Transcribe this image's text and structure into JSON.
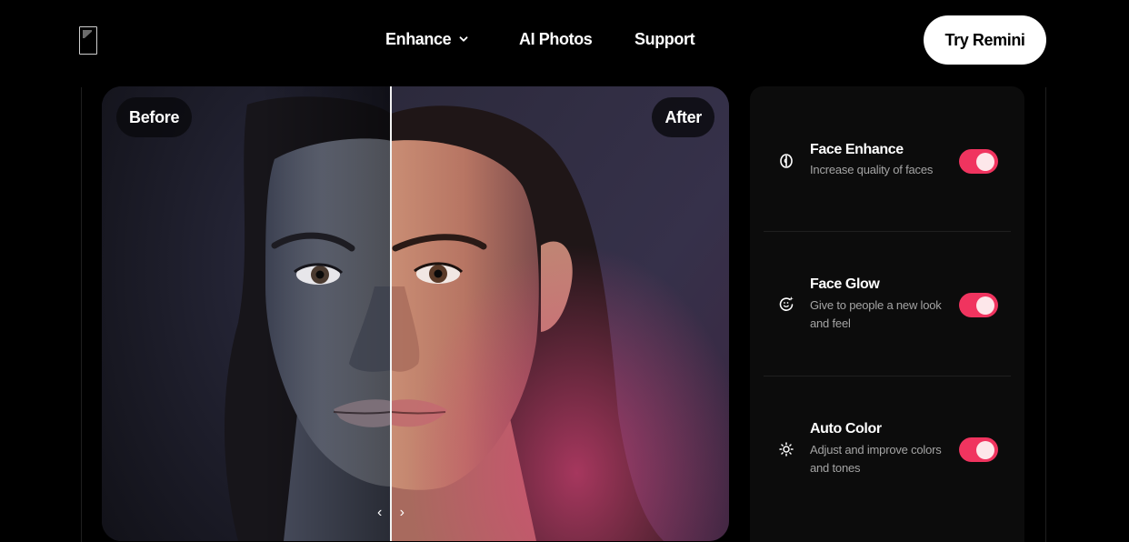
{
  "header": {
    "nav": [
      {
        "label": "Enhance",
        "has_dropdown": true,
        "icon": "chevron-down-icon"
      },
      {
        "label": "AI Photos",
        "has_dropdown": false
      },
      {
        "label": "Support",
        "has_dropdown": false
      }
    ],
    "cta_label": "Try Remini"
  },
  "compare": {
    "before_label": "Before",
    "after_label": "After",
    "split_fraction": 0.46,
    "handle_icon": "chevron-left-right-icon"
  },
  "features": [
    {
      "title": "Face Enhance",
      "description": "Increase quality of faces",
      "icon": "face-enhance-icon",
      "enabled": true
    },
    {
      "title": "Face Glow",
      "description": "Give to people a new look and feel",
      "icon": "face-glow-icon",
      "enabled": true
    },
    {
      "title": "Auto Color",
      "description": "Adjust and improve colors and tones",
      "icon": "sun-icon",
      "enabled": true
    }
  ],
  "colors": {
    "background": "#000000",
    "panel": "#0c0c0c",
    "toggle_on": "#f0345f",
    "cta_bg": "#ffffff"
  }
}
